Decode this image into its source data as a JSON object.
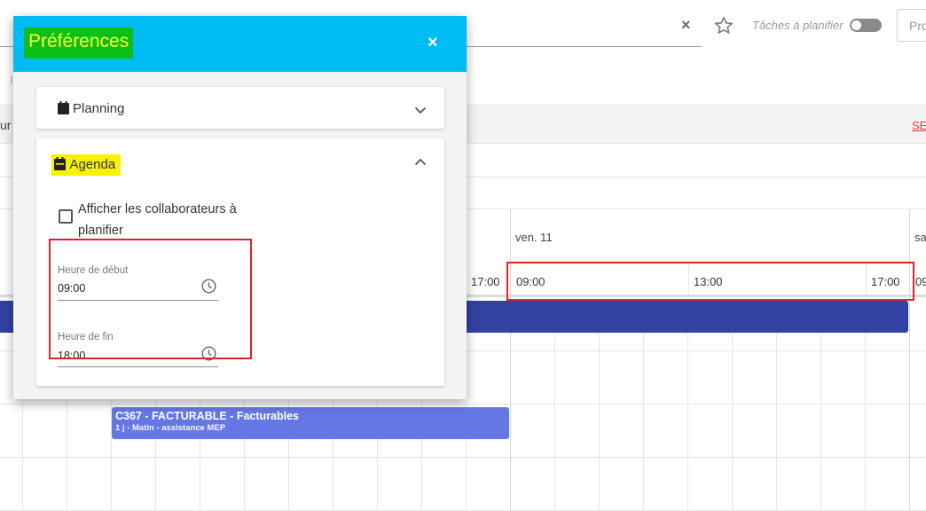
{
  "toolbar": {
    "clear_symbol": "×",
    "star_icon": "star-icon",
    "tasks_label": "Tâches à planifier",
    "tasks_toggle_on": false,
    "action_button_label": "Pro"
  },
  "band": {
    "left_text": "ur",
    "right_link": "SE"
  },
  "calendar": {
    "days": [
      {
        "label": "ven. 11"
      },
      {
        "label": "sa"
      }
    ],
    "times": [
      "17:00",
      "09:00",
      "13:00",
      "17:00",
      "09"
    ],
    "event": {
      "title": "C367 - FACTURABLE - Facturables",
      "subtitle": "1 j - Matin - assistance MEP"
    }
  },
  "dialog": {
    "title": "Préférences",
    "close_symbol": "×",
    "sections": [
      {
        "label": "Planning",
        "icon": "calendar-icon",
        "expanded": false
      },
      {
        "label": "Agenda",
        "icon": "calendar-icon",
        "expanded": true
      }
    ],
    "agenda": {
      "checkbox_label": "Afficher les collaborateurs à planifier",
      "checkbox_checked": false,
      "start_label": "Heure de début",
      "start_value": "09:00",
      "end_label": "Heure de fin",
      "end_value": "18:00"
    }
  },
  "colors": {
    "dialog_header": "#00bcf5",
    "title_highlight_bg": "#0bbf17",
    "title_highlight_text": "#ffff3a",
    "agenda_highlight": "#f6f200",
    "annotation_red": "#d9262b",
    "big_bar": "#3242a2",
    "event_bar": "#6577e3"
  }
}
